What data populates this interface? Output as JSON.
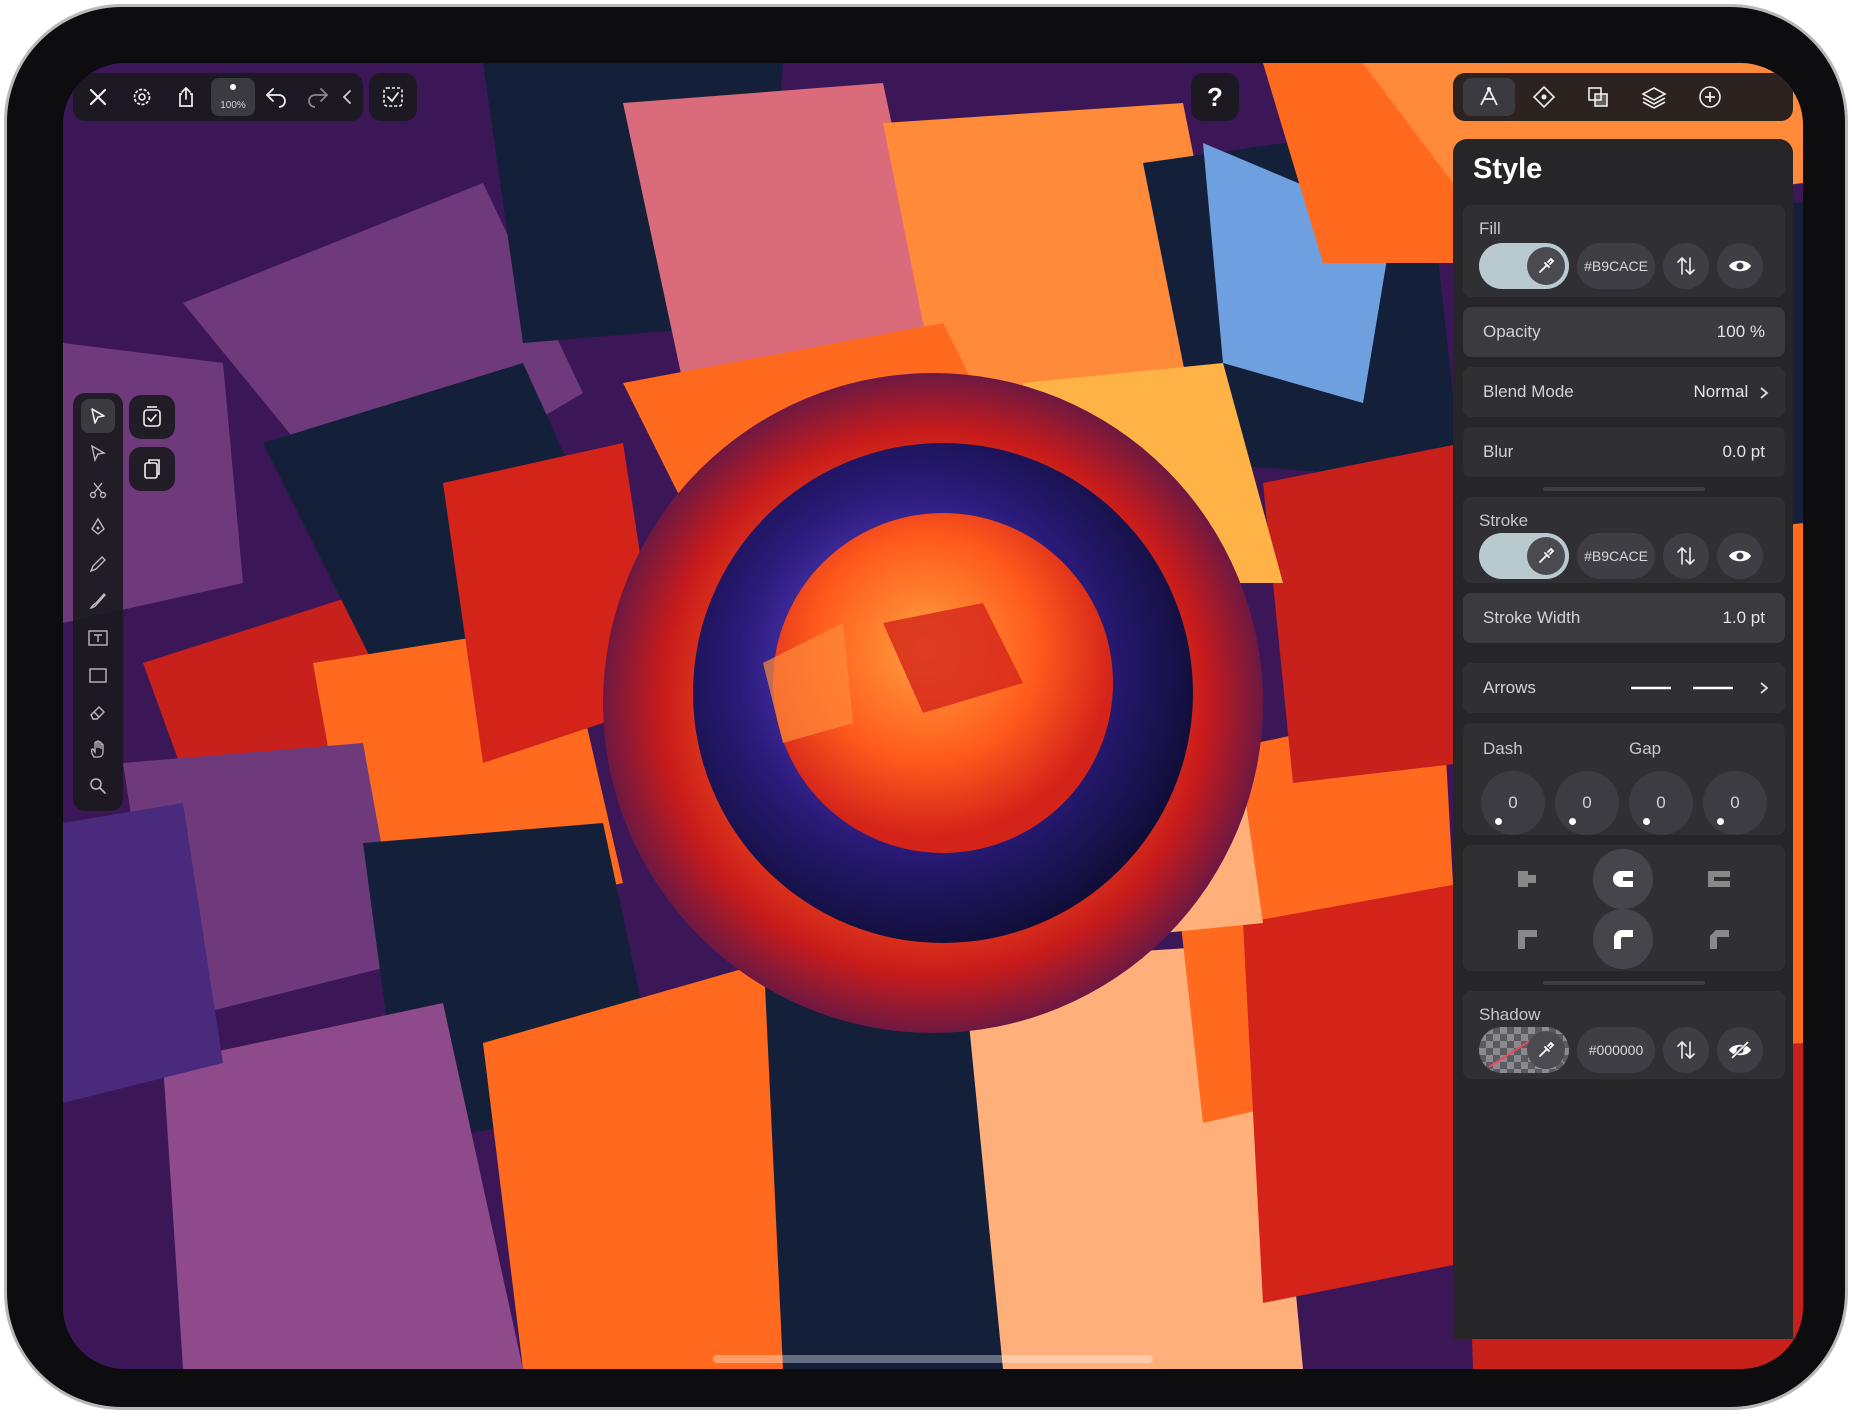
{
  "top_left_toolbar": {
    "zoom_label": "100%"
  },
  "top_right_toolbar": {
    "help_label": "?"
  },
  "style_panel": {
    "title": "Style",
    "fill": {
      "label": "Fill",
      "color_hex": "#B9CACE",
      "swatch_color": "#b9cace"
    },
    "opacity": {
      "label": "Opacity",
      "value": "100 %"
    },
    "blend_mode": {
      "label": "Blend Mode",
      "value": "Normal"
    },
    "blur": {
      "label": "Blur",
      "value": "0.0 pt"
    },
    "stroke": {
      "label": "Stroke",
      "color_hex": "#B9CACE",
      "swatch_color": "#b9cace"
    },
    "stroke_width": {
      "label": "Stroke Width",
      "value": "1.0 pt"
    },
    "arrows": {
      "label": "Arrows"
    },
    "dash_gap": {
      "dash_label": "Dash",
      "gap_label": "Gap",
      "values": [
        "0",
        "0",
        "0",
        "0"
      ]
    },
    "shadow": {
      "label": "Shadow",
      "color_hex": "#000000"
    }
  },
  "icons": {
    "top_left": [
      "close-icon",
      "settings-gear-icon",
      "share-icon",
      "zoom-indicator",
      "undo-icon",
      "redo-icon",
      "chevron-left-icon",
      "selection-check-icon"
    ],
    "top_right": [
      "style-brush-icon",
      "diamond-shape-icon",
      "boolean-ops-icon",
      "layers-icon",
      "add-icon"
    ],
    "tools": [
      "selection-arrow-icon",
      "direct-select-icon",
      "scissors-icon",
      "pen-tool-icon",
      "pencil-icon",
      "brush-icon",
      "text-box-icon",
      "rectangle-icon",
      "eraser-icon",
      "hand-icon",
      "zoom-icon"
    ],
    "side_actions": [
      "select-all-icon",
      "paste-icon"
    ]
  },
  "colors": {
    "panel_bg": "#262629",
    "card_bg": "#303034",
    "art_background": "#3b1758",
    "art_orange": "#ff6a1f",
    "art_red": "#c8201a",
    "art_navy": "#14203a"
  }
}
